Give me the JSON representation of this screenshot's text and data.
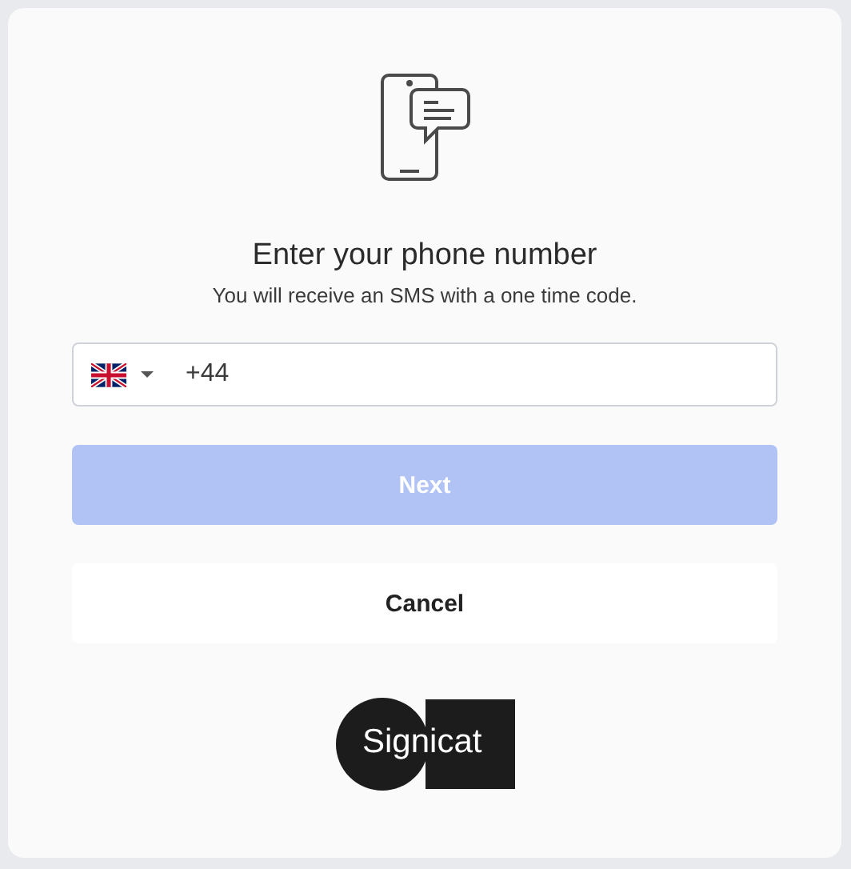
{
  "heading": "Enter your phone number",
  "subtitle": "You will receive an SMS with a one time code.",
  "phone_field": {
    "value": "+44"
  },
  "next_button": {
    "label": "Next",
    "disabled": true
  },
  "cancel_button": {
    "label": "Cancel"
  },
  "logo": {
    "text": "Signicat"
  }
}
